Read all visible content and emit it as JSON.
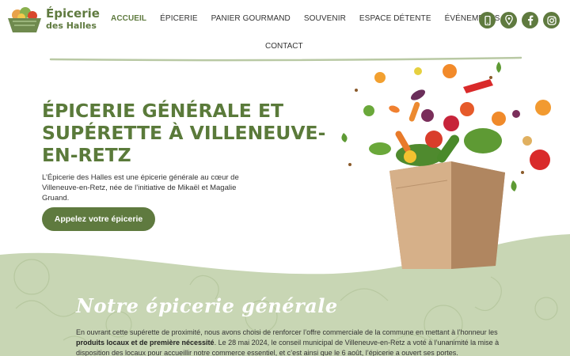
{
  "brand": {
    "line1": "Épicerie",
    "line2": "des Halles"
  },
  "nav": {
    "items": [
      "ACCUEIL",
      "ÉPICERIE",
      "PANIER GOURMAND",
      "SOUVENIR",
      "ESPACE DÉTENTE",
      "ÉVÉNEMENTS"
    ],
    "row2": "CONTACT",
    "active": "ACCUEIL"
  },
  "socials": [
    "phone-icon",
    "map-pin-icon",
    "facebook-icon",
    "instagram-icon"
  ],
  "hero": {
    "title": "ÉPICERIE GÉNÉRALE ET SUPÉRETTE À VILLENEUVE-EN-RETZ",
    "description": "L’Épicerie des Halles est une épicerie générale au cœur de Villeneuve-en-Retz, née de l’initiative de Mikaël et Magalie Gruand.",
    "button": "Appelez votre épicerie"
  },
  "section": {
    "title": "Notre épicerie générale",
    "text_part1": "En ouvrant cette supérette de proximité, nous avons choisi de renforcer l’offre commerciale de la commune en mettant à l’honneur les ",
    "text_bold": "produits locaux et de première nécessité",
    "text_part2": ". Le 28 mai 2024, le conseil municipal de Villeneuve-en-Retz a voté à l’unanimité la mise à disposition des locaux pour accueillir notre commerce essentiel, et c’est ainsi que le 6 août, l’épicerie a ouvert ses portes."
  },
  "colors": {
    "accent": "#5f7a3f",
    "band": "#c8d6b4",
    "title": "#5a7a3a"
  }
}
